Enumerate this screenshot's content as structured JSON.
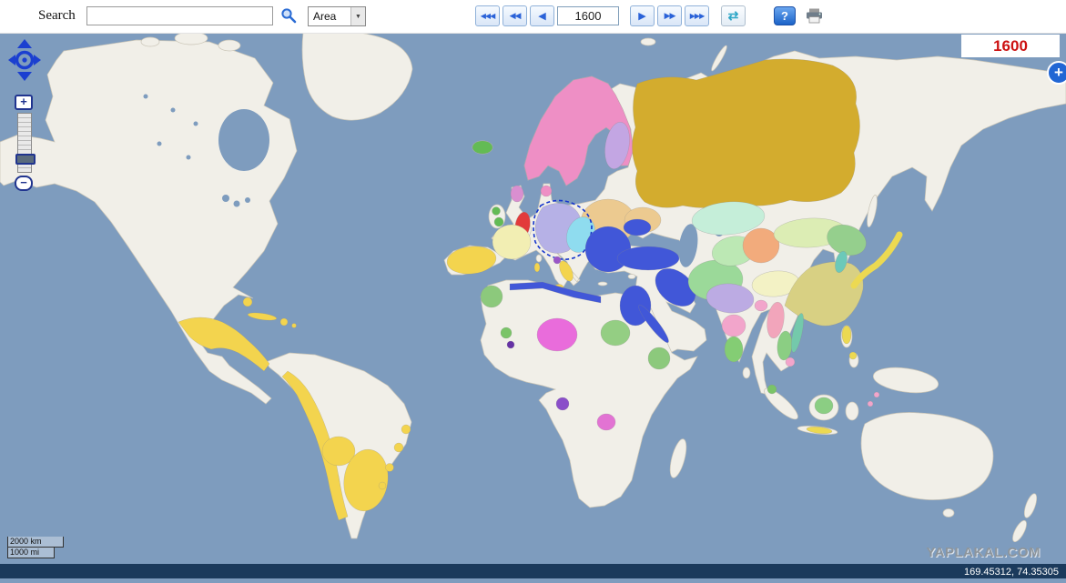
{
  "toolbar": {
    "search_label": "Search",
    "search_value": "",
    "area_select": {
      "value": "Area",
      "dropdown_icon": "▼"
    },
    "nav_buttons": [
      {
        "name": "jump-back",
        "label": "◀◀◀"
      },
      {
        "name": "back-10",
        "label": "◀◀"
      },
      {
        "name": "back-1",
        "label": "◀"
      },
      {
        "name": "fwd-1",
        "label": "▶"
      },
      {
        "name": "fwd-10",
        "label": "▶▶"
      },
      {
        "name": "jump-fwd",
        "label": "▶▶▶"
      }
    ],
    "year_value": "1600",
    "refresh_icon": "⇄",
    "help_label": "?"
  },
  "year_display": "1600",
  "map_controls": {
    "zoom_in": "+",
    "zoom_out": "−",
    "expand": "+"
  },
  "scale_bar": {
    "km": "2000 km",
    "mi": "1000 mi"
  },
  "watermark": "YAPLAKAL.COM",
  "status_bar": {
    "coordinates": "169.45312, 74.35305"
  },
  "map": {
    "year": "1600",
    "colors": {
      "ocean": "#7e9cbe",
      "land": "#f1efe8",
      "selection": "#1535cd",
      "year_red": "#cc1111",
      "bottombar": "#1b3a5c",
      "watermark_gray": "#8d959c",
      "england": "#e23b3b",
      "scotland": "#d98fd0",
      "ireland": "#63bb55",
      "iceland": "#63bb55",
      "scandinavia": "#ee8fc5",
      "finland": "#c3a6e3",
      "muscovy": "#d3ac2e",
      "poland": "#ecca90",
      "hre": "#b6b1e6",
      "austria": "#8fdcef",
      "france": "#f2eeb3",
      "spain": "#f3d44e",
      "papal": "#9a56c8",
      "ottoman": "#4157d8",
      "persia": "#9bd999",
      "kazakh": "#c5eed9",
      "uzbek": "#bce8b4",
      "oirat": "#f2ab7c",
      "mongolia": "#dcedb4",
      "tibet": "#f3f2c5",
      "ming": "#d8d083",
      "manchu": "#95cf8d",
      "korea": "#6cc9b9",
      "japan": "#ecd952",
      "mughal": "#bcabe3",
      "deccan": "#f2a5cb",
      "vijayanagar": "#84cd74",
      "burma": "#f2a5bb",
      "siam": "#8bce83",
      "vietnam": "#74c9ab",
      "philippines": "#ecd952",
      "java": "#ecd952",
      "borneo": "#8bce83",
      "moluccas": "#f2a5cb",
      "aceh": "#7ac468",
      "morocco": "#8cc97c",
      "songhai": "#e96cdb",
      "west_africa_green": "#7ac468",
      "west_africa_purple": "#6632a5",
      "bornu": "#94ce83",
      "ethiopia": "#8cc97c",
      "kongo": "#8a4fc9",
      "mutapa": "#e273d3",
      "new_spain": "#f3d44e",
      "peru": "#f3d44e",
      "brazil": "#f3d44e"
    }
  }
}
